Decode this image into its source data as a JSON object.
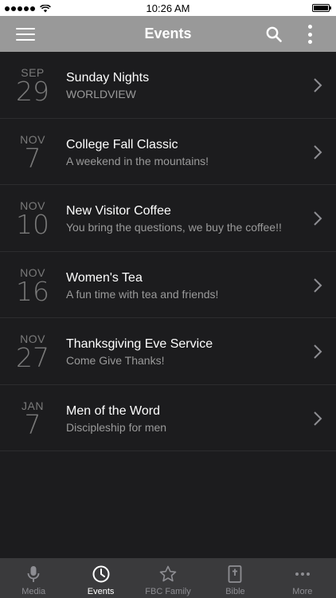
{
  "status_bar": {
    "time": "10:26 AM"
  },
  "header": {
    "title": "Events"
  },
  "events": [
    {
      "month": "SEP",
      "day": "29",
      "title": "Sunday Nights",
      "subtitle": "WORLDVIEW"
    },
    {
      "month": "NOV",
      "day": "7",
      "title": "College Fall Classic",
      "subtitle": "A weekend in the mountains!"
    },
    {
      "month": "NOV",
      "day": "10",
      "title": "New Visitor Coffee",
      "subtitle": "You bring the questions, we buy the coffee!!"
    },
    {
      "month": "NOV",
      "day": "16",
      "title": "Women's Tea",
      "subtitle": "A fun time with tea and friends!"
    },
    {
      "month": "NOV",
      "day": "27",
      "title": "Thanksgiving Eve Service",
      "subtitle": "Come Give Thanks!"
    },
    {
      "month": "JAN",
      "day": "7",
      "title": "Men of the Word",
      "subtitle": "Discipleship for men"
    }
  ],
  "tabs": [
    {
      "label": "Media",
      "icon": "microphone-icon",
      "active": false
    },
    {
      "label": "Events",
      "icon": "clock-icon",
      "active": true
    },
    {
      "label": "FBC Family",
      "icon": "star-icon",
      "active": false
    },
    {
      "label": "Bible",
      "icon": "bible-icon",
      "active": false
    },
    {
      "label": "More",
      "icon": "more-icon",
      "active": false
    }
  ],
  "colors": {
    "nav_bar": "#999999",
    "background": "#1c1c1e",
    "tab_bar": "#3a3a3c"
  }
}
